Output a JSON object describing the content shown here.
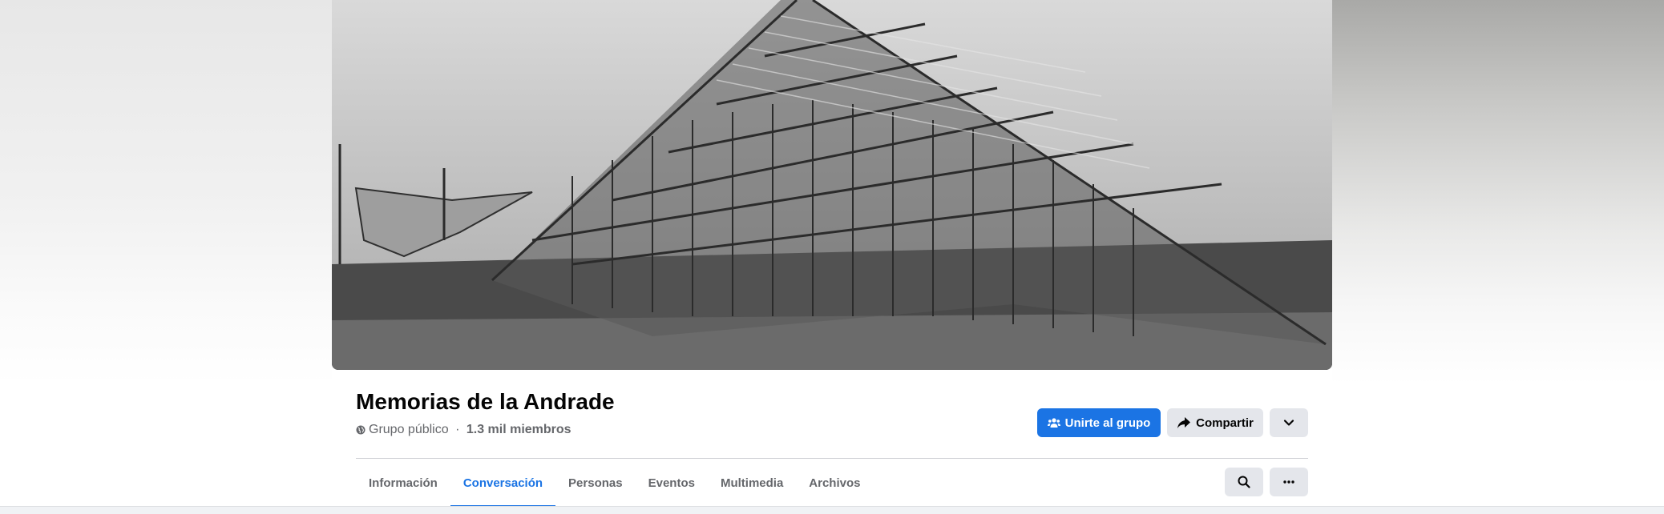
{
  "group": {
    "name": "Memorias de la Andrade",
    "privacy": "Grupo público",
    "separator": " · ",
    "members": "1.3 mil miembros"
  },
  "actions": {
    "join_label": "Unirte al grupo",
    "share_label": "Compartir"
  },
  "tabs": [
    {
      "label": "Información"
    },
    {
      "label": "Conversación"
    },
    {
      "label": "Personas"
    },
    {
      "label": "Eventos"
    },
    {
      "label": "Multimedia"
    },
    {
      "label": "Archivos"
    }
  ],
  "active_tab": "Conversación",
  "icons": {
    "privacy": "globe-icon",
    "join": "group-people-icon",
    "share": "share-arrow-icon",
    "more": "chevron-down-icon",
    "search": "search-icon",
    "options": "ellipsis-icon"
  },
  "colors": {
    "accent": "#1b74e4",
    "secondary_button": "#e4e6eb",
    "text_primary": "#050505",
    "text_secondary": "#65676b"
  }
}
